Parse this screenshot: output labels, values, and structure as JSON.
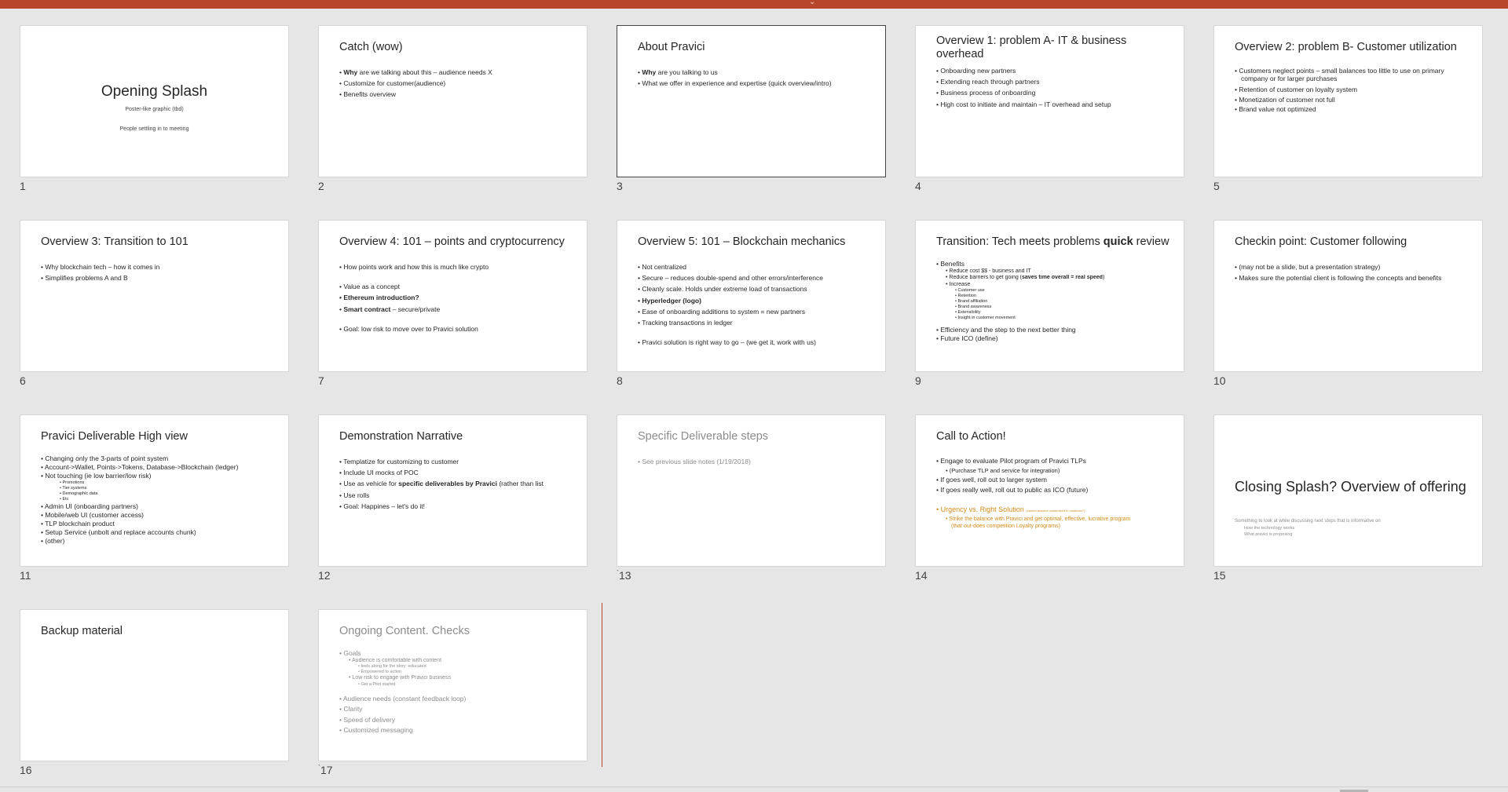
{
  "slides": [
    {
      "num": "1",
      "title": "Opening Splash",
      "sub1": "Poster-like graphic (tbd)",
      "sub2": "People settling in to meeting"
    },
    {
      "num": "2",
      "title": "Catch (wow)",
      "b1_bold": "Why",
      "b1_rest": " are we talking about this – audience needs X",
      "b2": "Customize for customer(audience)",
      "b3": "Benefits overview"
    },
    {
      "num": "3",
      "title": "About Pravici",
      "b1_bold": "Why",
      "b1_rest": " are you talking to us",
      "b2": "What we offer in experience and expertise (quick overview/intro)"
    },
    {
      "num": "4",
      "title": "Overview 1: problem A- IT & business overhead",
      "b1": "Onboarding new partners",
      "b2": "Extending reach through partners",
      "b3": "Business process of onboarding",
      "b4": "High cost to initiate and maintain – IT overhead and setup"
    },
    {
      "num": "5",
      "title": "Overview 2: problem B- Customer utilization",
      "b1": "Customers neglect points – small balances too little to use on primary company or for larger purchases",
      "b2": "Retention of customer on loyalty system",
      "b3": "Monetization of customer not full",
      "b4": "Brand value not optimized"
    },
    {
      "num": "6",
      "title": "Overview 3: Transition to 101",
      "b1": "Why blockchain tech – how it comes in",
      "b2": "Simplifies problems A and B"
    },
    {
      "num": "7",
      "title": "Overview 4: 101 – points and cryptocurrency",
      "b1": "How points work and how this is much like crypto",
      "b2": "Value as a concept",
      "b3": "Ethereum introduction?",
      "b4_bold": "Smart contract",
      "b4_rest": " – secure/private",
      "b5": "Goal: low risk to move over to Pravici solution"
    },
    {
      "num": "8",
      "title": "Overview 5: 101 – Blockchain mechanics",
      "b1": "Not centralized",
      "b2": "Secure – reduces double-spend and other errors/interference",
      "b3": "Cleanly scale. Holds under extreme load of transactions",
      "b4": "Hyperledger (logo)",
      "b5": "Ease of onboarding additions to system = new partners",
      "b6": "Tracking transactions in ledger",
      "b7": "Pravici solution is right way to go – (we get it, work with us)"
    },
    {
      "num": "9",
      "title_pre": "Transition: Tech meets problems ",
      "title_bold": "quick",
      "title_post": " review",
      "b1": "Benefits",
      "b1a": "Reduce cost $$ - business and IT",
      "b1b_pre": "Reduce barriers to get going (",
      "b1b_bold": "saves time overall = real speed",
      "b1b_post": ")",
      "b1c": "Increase",
      "b1c1": "Customer use",
      "b1c2": "Retention",
      "b1c3": "Brand affiliation",
      "b1c4": "Brand awareness",
      "b1c5": "Extensibility",
      "b1c6": "Insight in customer movement",
      "b2": "Efficiency and the step to the next better thing",
      "b3": "Future ICO (define)"
    },
    {
      "num": "10",
      "title": "Checkin point: Customer following",
      "b1": "(may not be a slide, but a presentation strategy)",
      "b2": "Makes sure the potential client is following the concepts and benefits"
    },
    {
      "num": "11",
      "title": "Pravici Deliverable High view",
      "b1": "Changing only the 3-parts of point system",
      "b2": "Account->Wallet, Points->Tokens, Database->Blockchain (ledger)",
      "b3": "Not touching (ie low barrier/low risk)",
      "b3a": "Promotions",
      "b3b": "Tier systems",
      "b3c": "Demographic data",
      "b3d": "Etc",
      "b4": "Admin UI (onboarding partners)",
      "b5": "Mobile/web UI (customer access)",
      "b6": "TLP blockchain product",
      "b7": "Setup Service (unbolt and replace accounts chunk)",
      "b8": "(other)"
    },
    {
      "num": "12",
      "title": "Demonstration Narrative",
      "b1": "Templatize for customizing to customer",
      "b2": "Include UI mocks of POC",
      "b3_pre": "Use as vehicle for ",
      "b3_bold": "specific deliverables by Pravici",
      "b3_post": " (rather than list",
      "b4": "Use rolls",
      "b5": "Goal: Happines – let's do it!"
    },
    {
      "num": "13",
      "title": "Specific Deliverable steps",
      "b1": "See previous slide notes (1/19/2018)"
    },
    {
      "num": "14",
      "title": "Call to Action!",
      "b1": "Engage to evaluate Pilot program of Pravici TLPs",
      "b1a": "(Purchase TLP and service for integration)",
      "b2": "If goes well, roll out to larger system",
      "b3": "If goes really well, roll out to public as ICO (future)",
      "b4": "Urgency vs. Right Solution",
      "b4_small": "(cannot assume customized to customer?)",
      "b4a": "Strike the balance with Pravici and get optimal, effective, lucrative program",
      "b4b": "(that out-does competition Loyalty programs)"
    },
    {
      "num": "15",
      "title": "Closing Splash? Overview of offering",
      "s1": "Something to look at while discussing next steps that is informative on",
      "s2": "How the technology works",
      "s3": "What pravici is proposing"
    },
    {
      "num": "16",
      "title": "Backup material"
    },
    {
      "num": "17",
      "title": "Ongoing Content. Checks",
      "b1": "Goals",
      "b1a": "Audience is comfortable with content",
      "b1a1": "feels along for the story -educated",
      "b1a2": "Empowered to action",
      "b1b": "Low risk to engage with Pravici business",
      "b1b1": "Get a Pilot started",
      "b2": "Audience needs (constant feedback loop)",
      "b3": "Clarity",
      "b4": "Speed of delivery",
      "b5": "Customized messaging"
    }
  ],
  "colors": {
    "accent": "#b7472a",
    "background": "#e6e6e6",
    "highlight": "#d08b1a"
  }
}
